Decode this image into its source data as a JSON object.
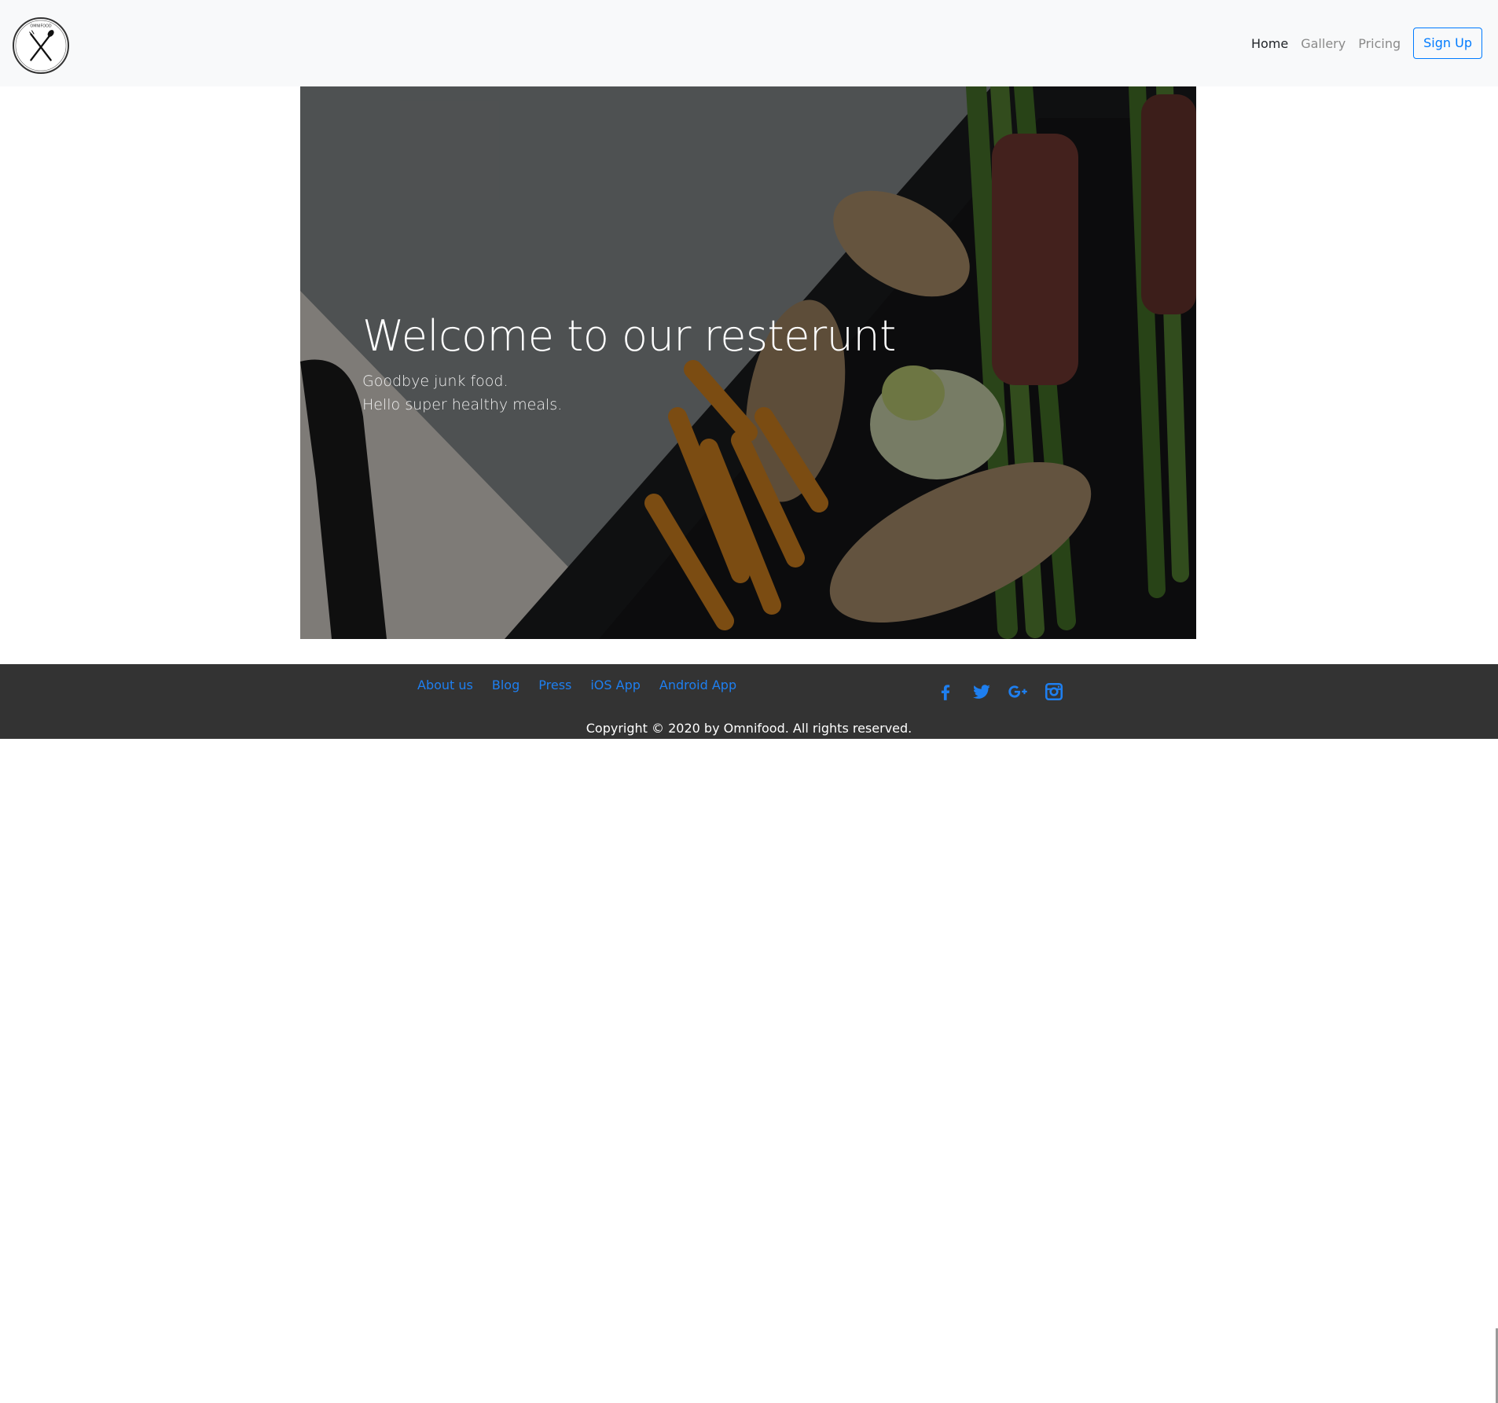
{
  "navbar": {
    "logo_icon": "fork-spoon-logo-icon",
    "links": [
      {
        "label": "Home",
        "active": true
      },
      {
        "label": "Gallery",
        "active": false
      },
      {
        "label": "Pricing",
        "active": false
      }
    ],
    "signup_label": "Sign Up"
  },
  "hero": {
    "title": "Welcome to our resterunt",
    "subtitle_line1": "Goodbye junk food.",
    "subtitle_line2": "Hello super healthy meals."
  },
  "footer": {
    "links": [
      "About us",
      "Blog",
      "Press",
      "iOS App",
      "Android App"
    ],
    "social_icons": [
      "facebook-icon",
      "twitter-icon",
      "google-plus-icon",
      "instagram-icon"
    ],
    "copyright": "Copyright © 2020 by Omnifood. All rights reserved."
  },
  "colors": {
    "link_blue": "#007bff",
    "footer_bg": "#333333",
    "navbar_bg": "#f8f9fa"
  }
}
